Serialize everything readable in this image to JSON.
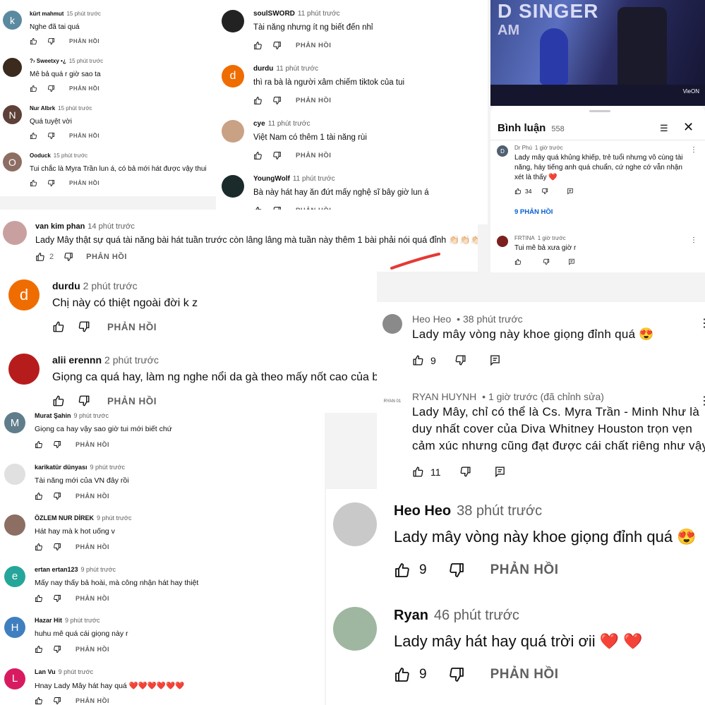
{
  "reply_label": "PHẢN HỒI",
  "panel_a": [
    {
      "initial": "k",
      "color": "#5b8aa0",
      "name": "kürt mahmut",
      "time": "15 phút trước",
      "text": "Nghe đã tai quá"
    },
    {
      "initial": "",
      "color": "#3b2a1e",
      "name": "?› Sweetxy •¿",
      "time": "15 phút trước",
      "text": "Mê bả quá r giờ sao ta"
    },
    {
      "initial": "N",
      "color": "#5d4037",
      "name": "Nur Albrk",
      "time": "15 phút trước",
      "text": "Quá tuyệt vời"
    },
    {
      "initial": "O",
      "color": "#8d6e63",
      "name": "Ooduck",
      "time": "15 phút trước",
      "text": "Tui chắc là Myra Trần lun á, có bả mới hát được vậy thui"
    }
  ],
  "panel_b": [
    {
      "initial": "",
      "color": "#222222",
      "name": "soulSWORD",
      "time": "11 phút trước",
      "text": "Tài năng nhưng ít ng biết đến nhỉ"
    },
    {
      "initial": "d",
      "color": "#ef6c00",
      "name": "durdu",
      "time": "11 phút trước",
      "text": "thì ra bà là người xâm chiếm tiktok của tui"
    },
    {
      "initial": "",
      "color": "#c9a184",
      "name": "cye",
      "time": "11 phút trước",
      "text": "Việt Nam có thêm 1 tài năng rùi"
    },
    {
      "initial": "",
      "color": "#1b2a2a",
      "name": "YoungWolf",
      "time": "11 phút trước",
      "text": "Bà này hát hay ăn đứt mấy nghệ sĩ bây giờ lun á"
    }
  ],
  "video": {
    "overlay_text": "D SINGER",
    "overlay_text2": "AM",
    "channel_logo": "VieON"
  },
  "comments_sheet": {
    "title": "Bình luận",
    "count": "558",
    "comments": [
      {
        "initial": "D",
        "name": "Dr Phú",
        "time": "1 giờ trước",
        "text": [
          "Lady mây quá khủng khiếp, trẻ tuổi nhưng vô cùng tài",
          "năng, háy tiếng anh quá chuẩn, cứ nghe cớ vẫn nhận",
          "xét là thấy ❤️"
        ],
        "likes": "34",
        "replies": "9 PHẢN HỒI"
      },
      {
        "initial": "",
        "name": "FRTINA",
        "time": "1 giờ trước",
        "text": [
          "Tui mê bả xưa giờ r"
        ],
        "likes": "",
        "replies": ""
      }
    ]
  },
  "panel_kim": {
    "name": "van kim phan",
    "time": "14 phút trước",
    "text": "Lady Mây thật sự quá tài năng bài hát tuần trước còn lâng lâng mà tuần này thêm 1 bài phải nói quá đỉnh 👏🏻👏🏻👏🏻",
    "likes": "2"
  },
  "panel_big": [
    {
      "initial": "d",
      "color": "#ef6c00",
      "name": "durdu",
      "time": "2 phút trước",
      "text": "Chị này có thiệt ngoài đời k z"
    },
    {
      "initial": "",
      "color": "#b71c1c",
      "name": "alii erennn",
      "time": "2 phút trước",
      "text": "Giọng ca quá hay, làm ng nghe nổi da gà theo mấy nốt cao của bả"
    }
  ],
  "panel_heo": [
    {
      "name": "Heo Heo",
      "time": "38 phút trước",
      "text": [
        "Lady mây vòng này khoe giọng đỉnh quá 😍"
      ],
      "likes": "9"
    },
    {
      "name": "RYAN HUYNH",
      "time": "1 giờ trước (đã chỉnh sửa)",
      "text": [
        "Lady Mây, chỉ có thể là Cs. Myra Trần - Minh Như là",
        "duy nhất cover của Diva Whitney Houston trọn vẹn",
        "cảm xúc nhưng cũng đạt được cái chất riêng như vậy!"
      ],
      "likes": "11",
      "avatar_text": "RYAN 01"
    }
  ],
  "panel_c": [
    {
      "initial": "M",
      "color": "#607d8b",
      "name": "Murat Şahin",
      "time": "9 phút trước",
      "text": "Giọng ca hay vậy sao giờ tui mới biết chứ"
    },
    {
      "initial": "",
      "color": "#e0e0e0",
      "name": "karikatür dünyası",
      "time": "9 phút trước",
      "text": "Tài năng mới của VN đây rồi"
    },
    {
      "initial": "",
      "color": "#8d6e63",
      "name": "ÖZLEM NUR DİREK",
      "time": "9 phút trước",
      "text": "Hát hay mà k hot uống v"
    },
    {
      "initial": "e",
      "color": "#26a69a",
      "name": "ertan ertan123",
      "time": "9 phút trước",
      "text": "Mấy nay thấy bả hoài, mà công nhận hát hay thiệt"
    },
    {
      "initial": "H",
      "color": "#3f7fbf",
      "name": "Hazar Hit",
      "time": "9 phút trước",
      "text": "huhu mê quá cái giọng này r"
    },
    {
      "initial": "L",
      "color": "#d81b60",
      "name": "Lan Vu",
      "time": "9 phút trước",
      "text": "Hnay Lady Mây hát hay quá ❤️❤️❤️❤️❤️❤️"
    }
  ],
  "panel_d": [
    {
      "name": "Heo Heo",
      "time": "38 phút trước",
      "text": "Lady mây vòng này khoe giọng đỉnh quá 😍",
      "likes": "9"
    },
    {
      "name": "Ryan",
      "time": "46 phút trước",
      "text": "Lady mây hát hay quá trời ơii ❤️ ❤️",
      "likes": "9"
    }
  ],
  "colors": {
    "accent": "#065fd4",
    "heart": "#e53935",
    "red_stroke": "#e53935"
  }
}
